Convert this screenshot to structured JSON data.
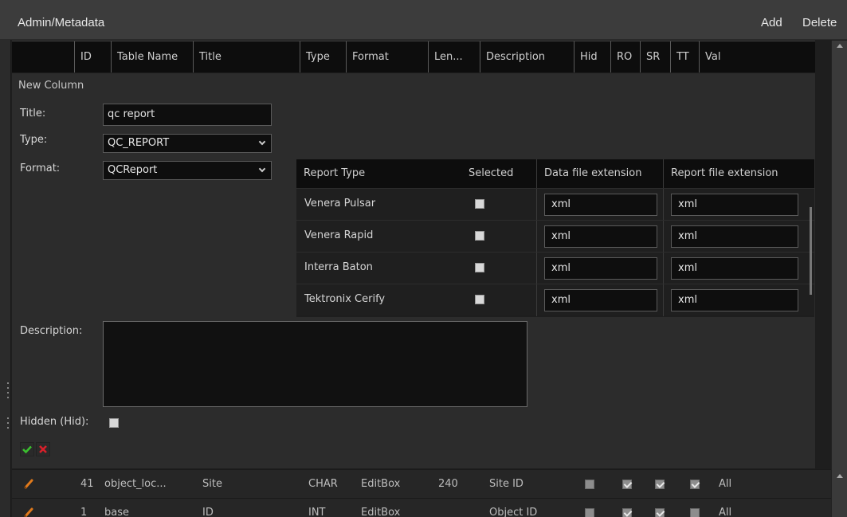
{
  "topbar": {
    "title": "Admin/Metadata",
    "add_label": "Add",
    "delete_label": "Delete"
  },
  "columns": [
    "ID",
    "Table Name",
    "Title",
    "Type",
    "Format",
    "Len...",
    "Description",
    "Hid",
    "RO",
    "SR",
    "TT",
    "Val"
  ],
  "form": {
    "heading": "New Column",
    "title_label": "Title:",
    "title_value": "qc report",
    "type_label": "Type:",
    "type_value": "QC_REPORT",
    "format_label": "Format:",
    "format_value": "QCReport",
    "description_label": "Description:",
    "description_value": "",
    "hidden_label": "Hidden (Hid):",
    "hidden_checked": false
  },
  "report_table": {
    "headers": [
      "Report Type",
      "Selected",
      "Data file extension",
      "Report file extension"
    ],
    "rows": [
      {
        "type": "Venera Pulsar",
        "selected": false,
        "data_ext": "xml",
        "report_ext": "xml"
      },
      {
        "type": "Venera Rapid",
        "selected": false,
        "data_ext": "xml",
        "report_ext": "xml"
      },
      {
        "type": "Interra Baton",
        "selected": false,
        "data_ext": "xml",
        "report_ext": "xml"
      },
      {
        "type": "Tektronix Cerify",
        "selected": false,
        "data_ext": "xml",
        "report_ext": "xml"
      }
    ]
  },
  "data_rows": [
    {
      "id": "41",
      "table_name": "object_loc...",
      "title": "Site",
      "type": "CHAR",
      "format": "EditBox",
      "length": "240",
      "description": "Site ID",
      "hid": false,
      "ro": true,
      "sr": true,
      "tt": true,
      "val": "All"
    },
    {
      "id": "1",
      "table_name": "base",
      "title": "ID",
      "type": "INT",
      "format": "EditBox",
      "length": "",
      "description": "Object ID",
      "hid": false,
      "ro": true,
      "sr": true,
      "tt": false,
      "val": "All"
    }
  ],
  "icons": {
    "ok": "check-icon",
    "cancel": "cross-icon",
    "edit": "pencil-icon"
  },
  "colors": {
    "ok_green": "#3bbf2f",
    "cancel_red": "#d8202a",
    "pencil_orange": "#e07a1c"
  }
}
